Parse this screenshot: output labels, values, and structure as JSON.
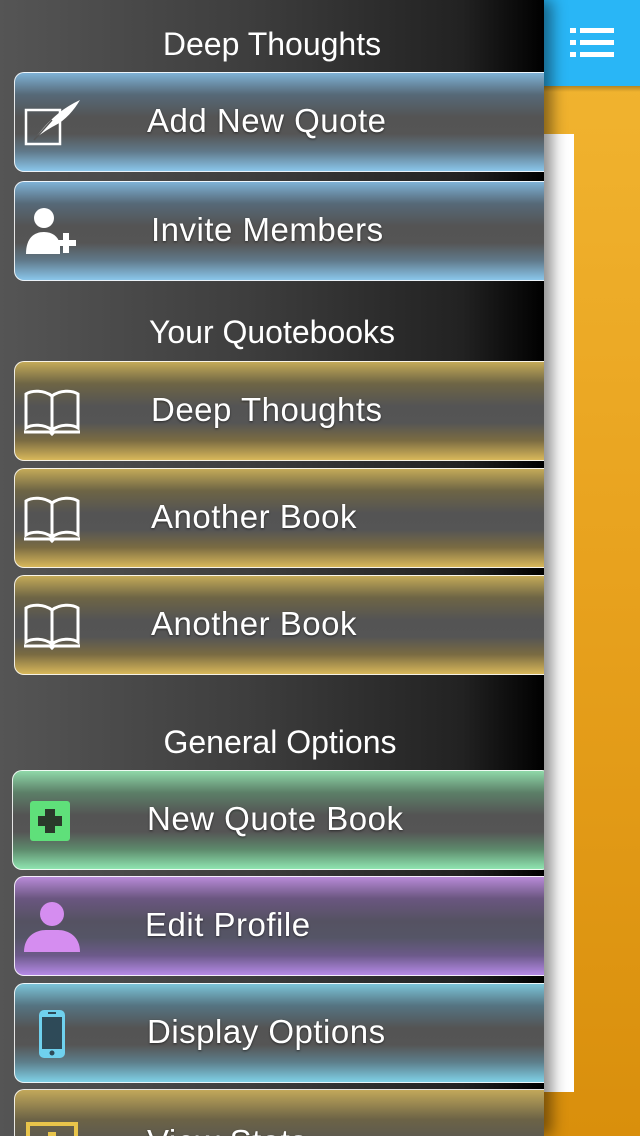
{
  "header": {
    "title": "Deep Thoughts"
  },
  "top_actions": [
    {
      "label": "Add New Quote",
      "icon": "quill-pen-icon"
    },
    {
      "label": "Invite Members",
      "icon": "add-user-icon"
    }
  ],
  "quotebooks": {
    "title": "Your Quotebooks",
    "items": [
      {
        "label": "Deep Thoughts",
        "icon": "open-book-icon"
      },
      {
        "label": "Another Book",
        "icon": "open-book-icon"
      },
      {
        "label": "Another Book",
        "icon": "open-book-icon"
      }
    ]
  },
  "general_options": {
    "title": "General Options",
    "items": [
      {
        "label": "New Quote Book",
        "icon": "plus-square-icon"
      },
      {
        "label": "Edit Profile",
        "icon": "person-icon"
      },
      {
        "label": "Display Options",
        "icon": "phone-icon"
      },
      {
        "label": "View Stats",
        "icon": "bar-chart-icon"
      }
    ]
  },
  "menu_button": {
    "icon": "list-menu-icon"
  },
  "colors": {
    "menu_button": "#29b6f6",
    "background_accent": "#f2b632",
    "sidebar": "#3e3e3e"
  }
}
